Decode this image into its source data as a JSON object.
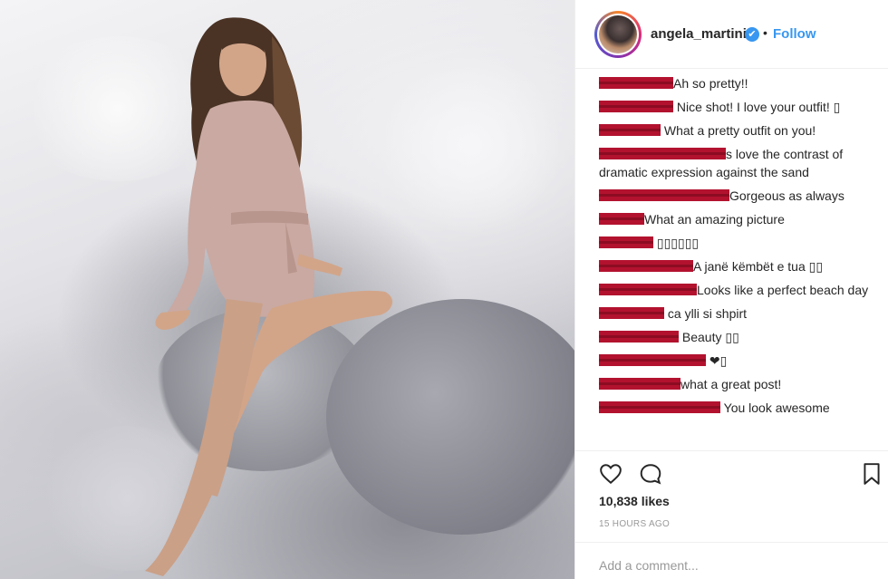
{
  "post": {
    "username": "angela_martini",
    "verified_mark": "✔",
    "separator": "•",
    "follow_label": "Follow",
    "likes": "10,838 likes",
    "timestamp": "15 HOURS AGO",
    "add_comment_placeholder": "Add a comment..."
  },
  "comments": [
    {
      "redacted_width": 82,
      "text": "Ah so pretty!!"
    },
    {
      "redacted_width": 82,
      "text": " Nice shot! I love your outfit! ▯"
    },
    {
      "redacted_width": 68,
      "text": " What a pretty outfit on you!"
    },
    {
      "redacted_width": 140,
      "text": "s love the contrast of dramatic expression against the sand"
    },
    {
      "redacted_width": 144,
      "text": "Gorgeous as always"
    },
    {
      "redacted_width": 50,
      "text": "What an amazing picture"
    },
    {
      "redacted_width": 60,
      "text": " ▯▯▯▯▯▯"
    },
    {
      "redacted_width": 104,
      "text": "A janë këmbët e tua ▯▯"
    },
    {
      "redacted_width": 108,
      "text": "Looks like a perfect beach day"
    },
    {
      "redacted_width": 72,
      "text": " ca ylli si shpirt"
    },
    {
      "redacted_width": 88,
      "text": " Beauty ▯▯"
    },
    {
      "redacted_width": 118,
      "text": " ❤▯"
    },
    {
      "redacted_width": 90,
      "text": "what a great post!"
    },
    {
      "redacted_width": 134,
      "text": " You look awesome"
    }
  ],
  "icons": {
    "like": "heart-icon",
    "comment": "comment-icon",
    "save": "bookmark-icon",
    "verified": "verified-badge-icon"
  },
  "colors": {
    "link": "#3897f0",
    "redaction": "#b3122f",
    "muted": "#999999"
  }
}
